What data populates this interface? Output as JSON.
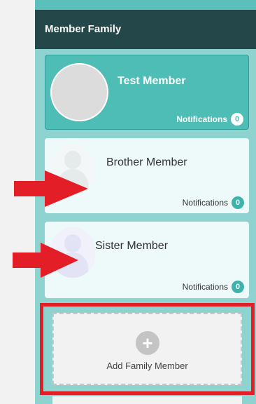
{
  "panel": {
    "title": "Member Family"
  },
  "members": [
    {
      "name": "Test Member",
      "notifications_label": "Notifications",
      "notifications_count": "0",
      "selected": true
    },
    {
      "name": "Brother Member",
      "notifications_label": "Notifications",
      "notifications_count": "0",
      "selected": false
    },
    {
      "name": "Sister Member",
      "notifications_label": "Notifications",
      "notifications_count": "0",
      "selected": false
    }
  ],
  "add_member": {
    "label": "Add Family Member",
    "icon": "plus-circle-icon"
  },
  "icons": {
    "avatar_placeholder": "user-silhouette-icon",
    "annotation_arrow": "arrow-right-icon"
  },
  "colors": {
    "header_bg": "#24474a",
    "panel_bg": "#8fd3d0",
    "selected_card": "#4dbdb6",
    "annotation_red": "#e41e26"
  }
}
